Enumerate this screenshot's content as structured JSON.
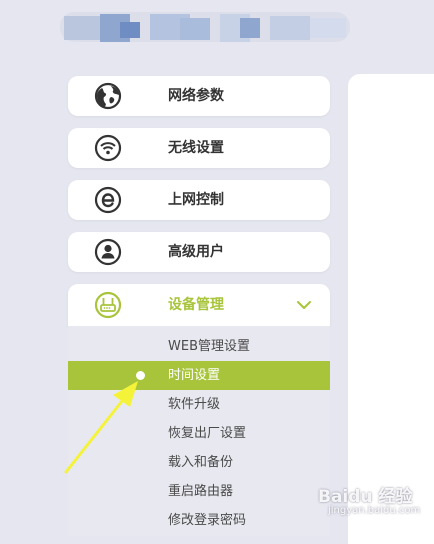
{
  "colors": {
    "accent": "#a7c43a",
    "background": "#e5e6ef",
    "text": "#333333"
  },
  "menu": {
    "items": [
      {
        "label": "网络参数",
        "icon": "globe-icon"
      },
      {
        "label": "无线设置",
        "icon": "wifi-icon"
      },
      {
        "label": "上网控制",
        "icon": "browser-e-icon"
      },
      {
        "label": "高级用户",
        "icon": "user-icon"
      },
      {
        "label": "设备管理",
        "icon": "router-icon",
        "expanded": true
      }
    ],
    "submenu": [
      {
        "label": "WEB管理设置"
      },
      {
        "label": "时间设置",
        "active": true
      },
      {
        "label": "软件升级"
      },
      {
        "label": "恢复出厂设置"
      },
      {
        "label": "载入和备份"
      },
      {
        "label": "重启路由器"
      },
      {
        "label": "修改登录密码"
      }
    ]
  },
  "watermark": {
    "main": "Baidu 经验",
    "sub": "jingyan.baidu.com"
  }
}
